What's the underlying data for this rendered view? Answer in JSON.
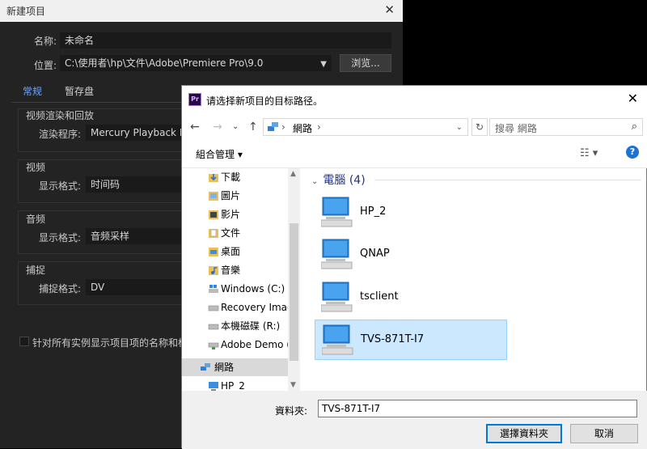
{
  "premiere": {
    "title": "新建项目",
    "name_label": "名称:",
    "name_value": "未命名",
    "location_label": "位置:",
    "location_value": "C:\\使用者\\hp\\文件\\Adobe\\Premiere Pro\\9.0",
    "browse_label": "浏览...",
    "tabs": [
      "常规",
      "暂存盘"
    ],
    "sections": {
      "video_render": "视频渲染和回放",
      "renderer_label": "渲染程序:",
      "renderer_value": "Mercury Playback Engine",
      "video": "视频",
      "video_format_label": "显示格式:",
      "video_format_value": "时间码",
      "audio": "音频",
      "audio_format_label": "显示格式:",
      "audio_format_value": "音频采样",
      "capture": "捕捉",
      "capture_format_label": "捕捉格式:",
      "capture_format_value": "DV",
      "checkbox_label": "针对所有实例显示项目项的名称和标"
    }
  },
  "dialog": {
    "title": "请选择新项目的目标路径。",
    "address_text": "網路",
    "search_placeholder": "搜尋 網路",
    "organize_label": "組合管理",
    "nav_items": [
      {
        "label": "下載",
        "icon": "download"
      },
      {
        "label": "圖片",
        "icon": "pictures"
      },
      {
        "label": "影片",
        "icon": "videos"
      },
      {
        "label": "文件",
        "icon": "documents"
      },
      {
        "label": "桌面",
        "icon": "desktop"
      },
      {
        "label": "音樂",
        "icon": "music"
      },
      {
        "label": "Windows (C:)",
        "icon": "drive"
      },
      {
        "label": "Recovery Image",
        "icon": "drive"
      },
      {
        "label": "本機磁碟 (R:)",
        "icon": "drive"
      },
      {
        "label": "Adobe Demo (V",
        "icon": "drive"
      },
      {
        "label": "網路",
        "icon": "network"
      },
      {
        "label": "HP_2",
        "icon": "computer"
      }
    ],
    "group_header": "電腦 (4)",
    "computers": [
      "HP_2",
      "QNAP",
      "tsclient",
      "TVS-871T-I7"
    ],
    "selected_computer": "TVS-871T-I7",
    "folder_label": "資料夾:",
    "folder_value": "TVS-871T-I7",
    "select_button": "選擇資料夾",
    "cancel_button": "取消"
  }
}
